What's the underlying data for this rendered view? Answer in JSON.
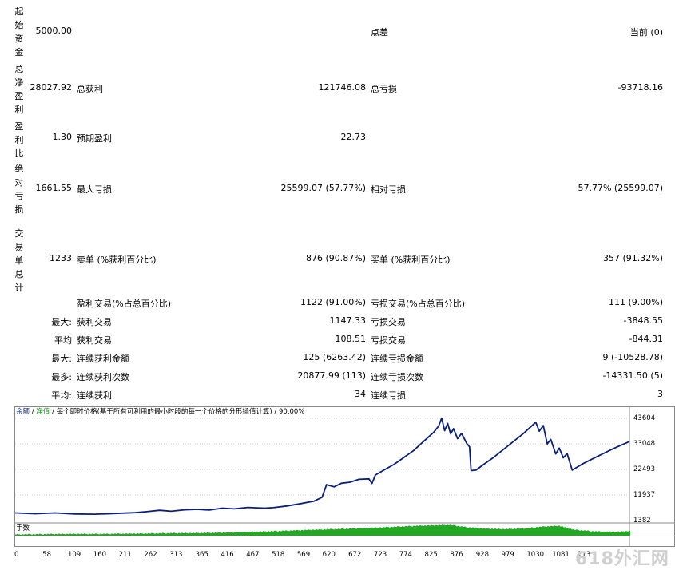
{
  "side_labels": [
    "起始资金",
    "总净盈利",
    "盈利比",
    "绝对亏损",
    "交易单总计"
  ],
  "row1": {
    "initial_deposit": "5000.00",
    "spread_label": "点差",
    "spread_value": "当前 (0)"
  },
  "row2": {
    "net_profit": "28027.92",
    "gross_profit_label": "总获利",
    "gross_profit": "121746.08",
    "gross_loss_label": "总亏损",
    "gross_loss": "-93718.16"
  },
  "row3": {
    "profit_factor": "1.30",
    "expected_payoff_label": "预期盈利",
    "expected_payoff": "22.73"
  },
  "row4": {
    "absolute_drawdown": "1661.55",
    "maximal_drawdown_label": "最大亏损",
    "maximal_drawdown": "25599.07 (57.77%)",
    "relative_drawdown_label": "相对亏损",
    "relative_drawdown": "57.77% (25599.07)"
  },
  "row5": {
    "total_trades": "1233",
    "short_label": "卖单 (%获利百分比)",
    "short_value": "876 (90.87%)",
    "long_label": "买单 (%获利百分比)",
    "long_value": "357 (91.32%)"
  },
  "row6": {
    "profit_trades_label": "盈利交易(%占总百分比)",
    "profit_trades": "1122 (91.00%)",
    "loss_trades_label": "亏损交易(%占总百分比)",
    "loss_trades": "111 (9.00%)"
  },
  "row7": {
    "prefix": "最大:",
    "label1": "获利交易",
    "value1": "1147.33",
    "label2": "亏损交易",
    "value2": "-3848.55"
  },
  "row8": {
    "prefix": "平均",
    "label1": "获利交易",
    "value1": "108.51",
    "label2": "亏损交易",
    "value2": "-844.31"
  },
  "row9": {
    "prefix": "最大:",
    "label1": "连续获利金额",
    "value1": "125 (6263.42)",
    "label2": "连续亏损金额",
    "value2": "9 (-10528.78)"
  },
  "row10": {
    "prefix": "最多:",
    "label1": "连续获利次数",
    "value1": "20877.99 (113)",
    "label2": "连续亏损次数",
    "value2": "-14331.50 (5)"
  },
  "row11": {
    "prefix": "平均:",
    "label1": "连续获利",
    "value1": "34",
    "label2": "连续亏损",
    "value2": "3"
  },
  "legend": {
    "balance": "余额",
    "sep1": " / ",
    "equity": "净值",
    "sep2": " / ",
    "description": "每个即时价格(基于所有可利用的最小时段的每一个价格的分形插值计算) / 90.00%"
  },
  "lots_label": "手数",
  "watermark": "618外汇网",
  "colors": {
    "balance_line": "#0a1f7a",
    "lots_bar": "#22a822",
    "grid": "#cfcfcf"
  },
  "chart_data": {
    "type": "line",
    "y_ticks": [
      "43604",
      "33048",
      "22493",
      "11937",
      "1382"
    ],
    "x_ticks": [
      "0",
      "58",
      "109",
      "160",
      "211",
      "262",
      "313",
      "365",
      "416",
      "467",
      "518",
      "569",
      "620",
      "672",
      "723",
      "774",
      "825",
      "876",
      "928",
      "979",
      "1030",
      "1081",
      "113"
    ],
    "ylim": [
      1382,
      43604
    ],
    "xlim": [
      0,
      1233
    ],
    "series": [
      {
        "x": [
          0,
          40,
          80,
          120,
          160,
          200,
          240,
          262,
          290,
          313,
          340,
          365,
          390,
          416,
          440,
          467,
          500,
          518,
          545,
          569,
          600,
          612,
          616,
          625,
          640,
          655,
          672,
          690,
          710,
          716,
          723,
          740,
          760,
          780,
          800,
          820,
          840,
          850,
          856,
          862,
          868,
          874,
          880,
          888,
          896,
          906,
          912,
          915,
          925,
          940,
          960,
          980,
          1000,
          1020,
          1045,
          1052,
          1060,
          1068,
          1075,
          1085,
          1092,
          1100,
          1108,
          1118,
          1140,
          1170,
          1200,
          1233
        ],
        "y": [
          4500,
          4200,
          4500,
          4100,
          4000,
          4300,
          4600,
          5000,
          5600,
          5200,
          5800,
          6000,
          5700,
          6500,
          6200,
          6800,
          6500,
          6700,
          7400,
          8200,
          9400,
          10600,
          11000,
          16200,
          15300,
          16800,
          17200,
          18400,
          18600,
          16700,
          20200,
          22200,
          24500,
          27400,
          30300,
          34100,
          37800,
          40400,
          43700,
          38500,
          41500,
          37200,
          39300,
          35200,
          37400,
          33300,
          31800,
          22000,
          22200,
          24500,
          27400,
          30700,
          34000,
          37300,
          42000,
          38300,
          40600,
          33000,
          34900,
          28900,
          31300,
          27300,
          29000,
          22200,
          24900,
          28000,
          31000,
          34000
        ]
      }
    ],
    "lots_levels": [
      [
        0,
        0.08
      ],
      [
        60,
        0.1
      ],
      [
        120,
        0.12
      ],
      [
        180,
        0.12
      ],
      [
        240,
        0.15
      ],
      [
        300,
        0.18
      ],
      [
        360,
        0.2
      ],
      [
        420,
        0.25
      ],
      [
        480,
        0.32
      ],
      [
        540,
        0.4
      ],
      [
        600,
        0.5
      ],
      [
        660,
        0.58
      ],
      [
        720,
        0.68
      ],
      [
        780,
        0.8
      ],
      [
        830,
        0.88
      ],
      [
        870,
        0.93
      ],
      [
        905,
        0.72
      ],
      [
        940,
        0.6
      ],
      [
        980,
        0.55
      ],
      [
        1020,
        0.62
      ],
      [
        1060,
        0.78
      ],
      [
        1090,
        0.85
      ],
      [
        1120,
        0.5
      ],
      [
        1160,
        0.35
      ],
      [
        1200,
        0.3
      ],
      [
        1233,
        0.38
      ]
    ]
  }
}
